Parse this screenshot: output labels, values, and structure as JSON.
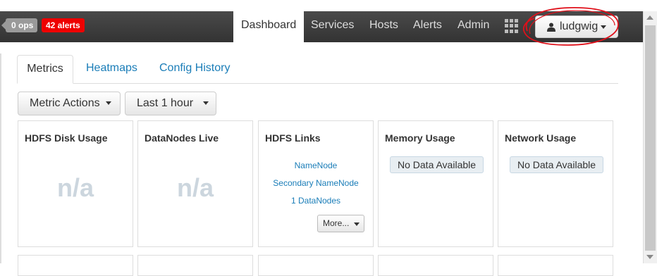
{
  "navbar": {
    "ops_badge": "0 ops",
    "alerts_badge": "42 alerts",
    "items": [
      "Dashboard",
      "Services",
      "Hosts",
      "Alerts",
      "Admin"
    ],
    "active_item": "Dashboard",
    "user_name": "ludgwig"
  },
  "tabs": {
    "items": [
      "Metrics",
      "Heatmaps",
      "Config History"
    ],
    "active": "Metrics"
  },
  "toolbar": {
    "metric_actions_label": "Metric Actions",
    "time_range_label": "Last 1 hour"
  },
  "widgets": [
    {
      "title": "HDFS Disk Usage",
      "value": "n/a"
    },
    {
      "title": "DataNodes Live",
      "value": "n/a"
    },
    {
      "title": "HDFS Links",
      "links": [
        "NameNode",
        "Secondary NameNode",
        "1 DataNodes"
      ],
      "more_label": "More..."
    },
    {
      "title": "Memory Usage",
      "status": "No Data Available"
    },
    {
      "title": "Network Usage",
      "status": "No Data Available"
    }
  ],
  "colors": {
    "navbar_bg": "#3c3c3c",
    "alerts_badge": "#ee0000",
    "ops_badge": "#9a9a9a",
    "link": "#1a7db8",
    "annotation_circle": "#e0101a"
  }
}
